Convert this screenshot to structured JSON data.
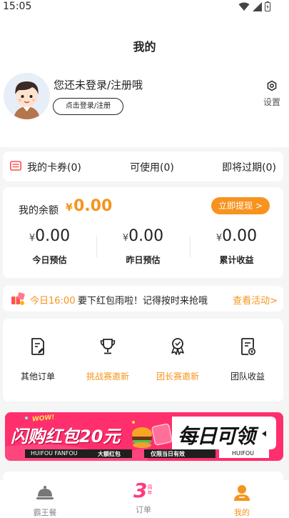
{
  "status_bar": {
    "time": "15:05"
  },
  "header": {
    "title": "我的"
  },
  "profile": {
    "login_prompt": "您还未登录/注册哦",
    "login_button": "点击登录/注册"
  },
  "settings": {
    "label": "设置"
  },
  "coupons": {
    "my_coupons": "我的卡券(0)",
    "available": "可使用(0)",
    "expiring": "即将过期(0)"
  },
  "balance": {
    "label": "我的余额",
    "currency": "¥",
    "amount": "0.00",
    "withdraw_button": "立即提现 >",
    "stats": [
      {
        "currency": "¥",
        "value": "0.00",
        "label": "今日预估"
      },
      {
        "currency": "¥",
        "value": "0.00",
        "label": "昨日预估"
      },
      {
        "currency": "¥",
        "value": "0.00",
        "label": "累计收益"
      }
    ]
  },
  "notice": {
    "time": "今日16:00",
    "message": "要下红包雨啦！记得按时来抢哦",
    "link": "查看活动>"
  },
  "menu": [
    {
      "label": "其他订单",
      "icon": "document-edit-icon",
      "color": "#222222"
    },
    {
      "label": "挑战赛邀新",
      "icon": "trophy-icon",
      "color": "#f5941d"
    },
    {
      "label": "团长赛邀新",
      "icon": "award-ribbon-icon",
      "color": "#f5941d"
    },
    {
      "label": "团队收益",
      "icon": "earnings-document-icon",
      "color": "#222222"
    }
  ],
  "banner": {
    "wow": "WOW!",
    "left_title": "闪购红包20元",
    "left_sub1": "HUIFOU FANFOU",
    "left_sub2": "大额红包",
    "right_title": "每日可领",
    "right_sub1": "仅限当日有效",
    "right_sub2": "HUIFOU"
  },
  "tabs": [
    {
      "label": "霸王餐",
      "icon": "cloche-icon",
      "active": false
    },
    {
      "label": "订单",
      "icon": "anniversary-3-icon",
      "badge": "3",
      "badge_text": "周年",
      "active": false
    },
    {
      "label": "我的",
      "icon": "person-icon",
      "active": true
    }
  ],
  "colors": {
    "accent": "#f5941d",
    "banner_pink": "#ff2e6e"
  }
}
